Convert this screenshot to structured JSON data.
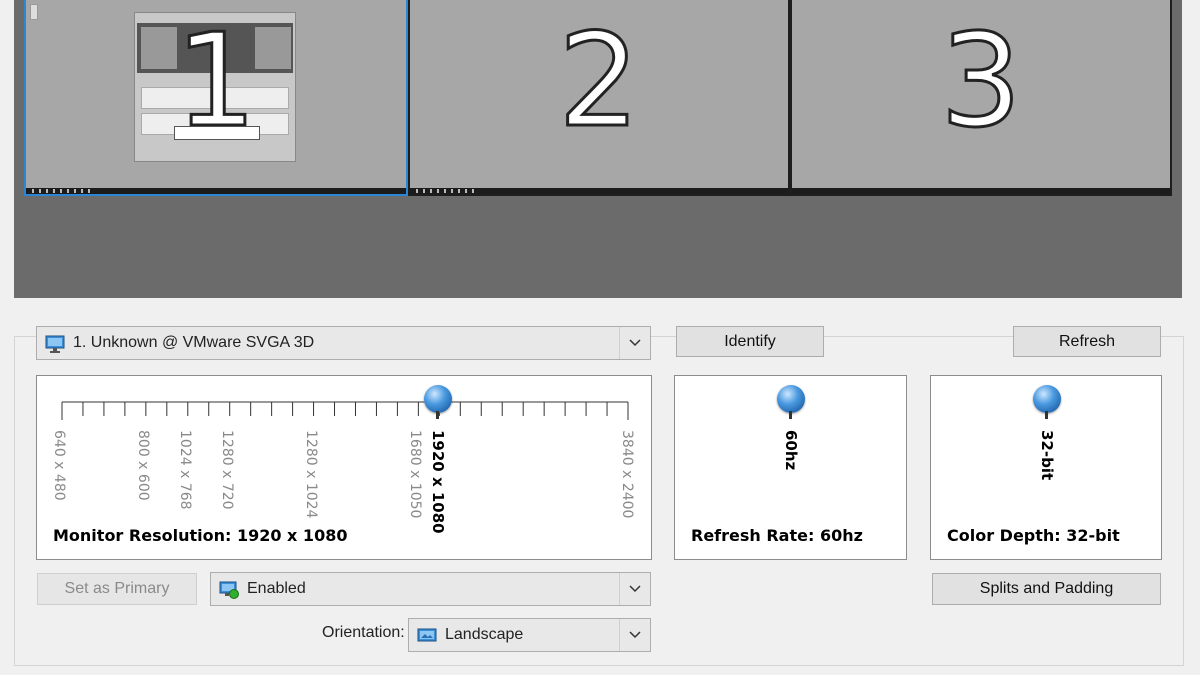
{
  "preview": {
    "monitors": [
      {
        "number": "1",
        "selected": true
      },
      {
        "number": "2",
        "selected": false
      },
      {
        "number": "3",
        "selected": false
      }
    ]
  },
  "display_select": {
    "value": "1. Unknown @ VMware SVGA 3D",
    "icon": "monitor-icon"
  },
  "buttons": {
    "identify": "Identify",
    "refresh": "Refresh",
    "set_primary": "Set as Primary",
    "splits_padding": "Splits and Padding"
  },
  "resolution": {
    "label": "Monitor Resolution: 1920 x 1080",
    "selected": "1920 x 1080",
    "ticks": [
      "640 x 480",
      "800 x 600",
      "1024 x 768",
      "1280 x 720",
      "1280 x 1024",
      "1680 x 1050",
      "1920 x 1080",
      "3840 x 2400"
    ]
  },
  "refresh_rate": {
    "label": "Refresh Rate: 60hz",
    "value": "60hz"
  },
  "color_depth": {
    "label": "Color Depth: 32-bit",
    "value": "32-bit"
  },
  "status_select": {
    "value": "Enabled",
    "icon": "monitor-enabled-icon"
  },
  "orientation": {
    "label": "Orientation:",
    "value": "Landscape",
    "icon": "landscape-icon"
  }
}
